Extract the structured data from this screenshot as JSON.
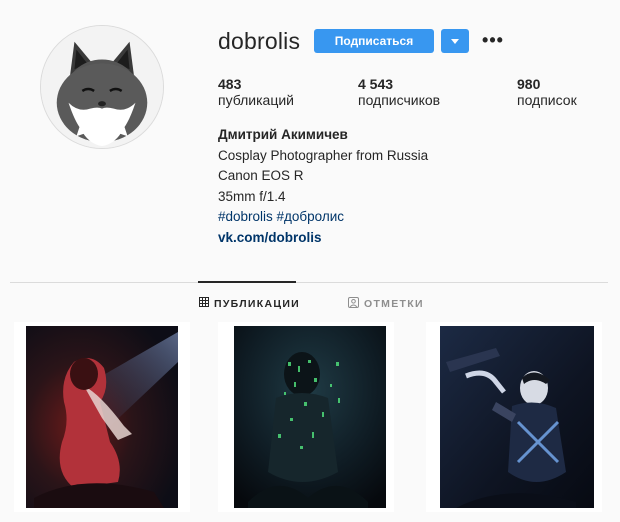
{
  "profile": {
    "username": "dobrolis",
    "follow_label": "Подписаться",
    "more_label": "•••"
  },
  "stats": [
    {
      "value": "483",
      "label": "публикаций"
    },
    {
      "value": "4 543",
      "label": "подписчиков"
    },
    {
      "value": "980",
      "label": "подписок"
    }
  ],
  "bio": {
    "name": "Дмитрий Акимичев",
    "lines": [
      "Cosplay Photographer from Russia",
      "Canon EOS R",
      "35mm f/1.4"
    ],
    "tags": "#dobrolis #добролис",
    "link": "vk.com/dobrolis"
  },
  "tabs": [
    {
      "label": "ПУБЛИКАЦИИ",
      "icon": "grid-icon",
      "active": true
    },
    {
      "label": "ОТМЕТКИ",
      "icon": "tag-person-icon",
      "active": false
    }
  ],
  "colors": {
    "accent": "#3897f0",
    "link": "#003569",
    "text": "#262626",
    "muted": "#8e8e8e"
  }
}
